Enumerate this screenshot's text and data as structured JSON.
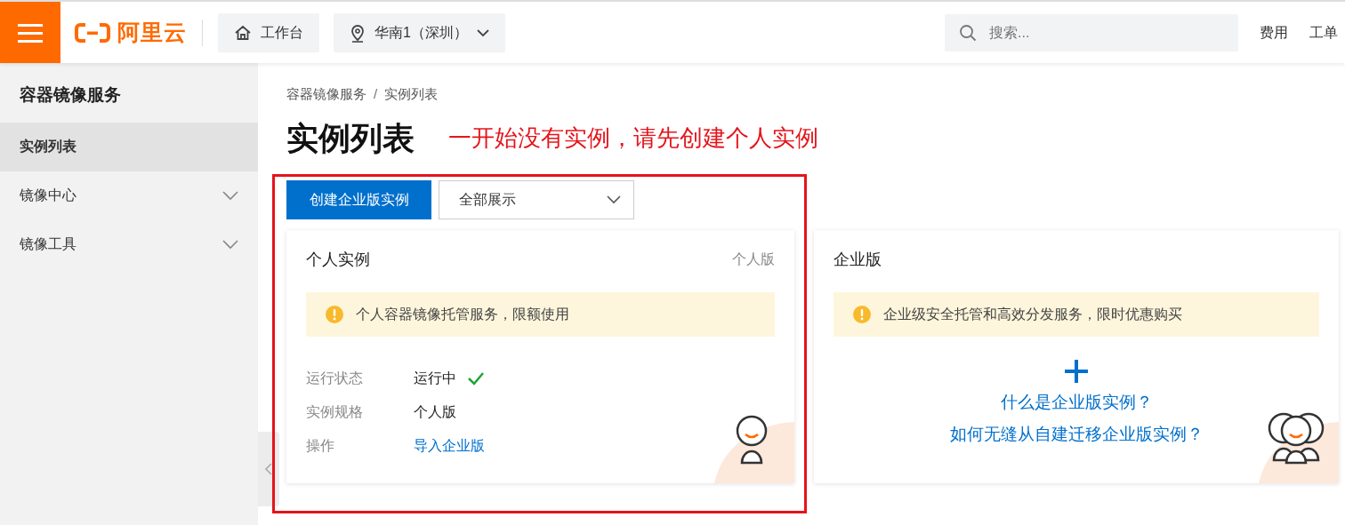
{
  "header": {
    "brand": "阿里云",
    "workbench": "工作台",
    "region": "华南1（深圳）",
    "search": {
      "placeholder": "搜索..."
    },
    "links": [
      "费用",
      "工单"
    ]
  },
  "sidebar": {
    "title": "容器镜像服务",
    "items": [
      {
        "label": "实例列表",
        "selected": true,
        "kind": "leaf"
      },
      {
        "label": "镜像中心",
        "selected": false,
        "expanded": false,
        "kind": "group"
      },
      {
        "label": "镜像工具",
        "selected": false,
        "expanded": false,
        "kind": "group"
      }
    ]
  },
  "breadcrumb": {
    "items": [
      "容器镜像服务",
      "实例列表"
    ],
    "separator": "/"
  },
  "page_title": "实例列表",
  "annotation": "一开始没有实例，请先创建个人实例",
  "toolbar": {
    "create_button": "创建企业版实例",
    "filter": "全部展示"
  },
  "cards": [
    {
      "kind": "instance",
      "title": "个人实例",
      "tag": "个人版",
      "notice": "个人容器镜像托管服务，限额使用",
      "fields": [
        {
          "label": "运行状态",
          "value": "运行中",
          "kind": "status",
          "ok": true
        },
        {
          "label": "实例规格",
          "value": "个人版",
          "kind": "text"
        },
        {
          "label": "操作",
          "value": "导入企业版",
          "kind": "link"
        }
      ]
    },
    {
      "kind": "promo",
      "title": "企业版",
      "notice": "企业级安全托管和高效分发服务，限时优惠购买",
      "links": [
        "什么是企业版实例？",
        "如何无缝从自建迁移企业版实例？"
      ]
    }
  ]
}
